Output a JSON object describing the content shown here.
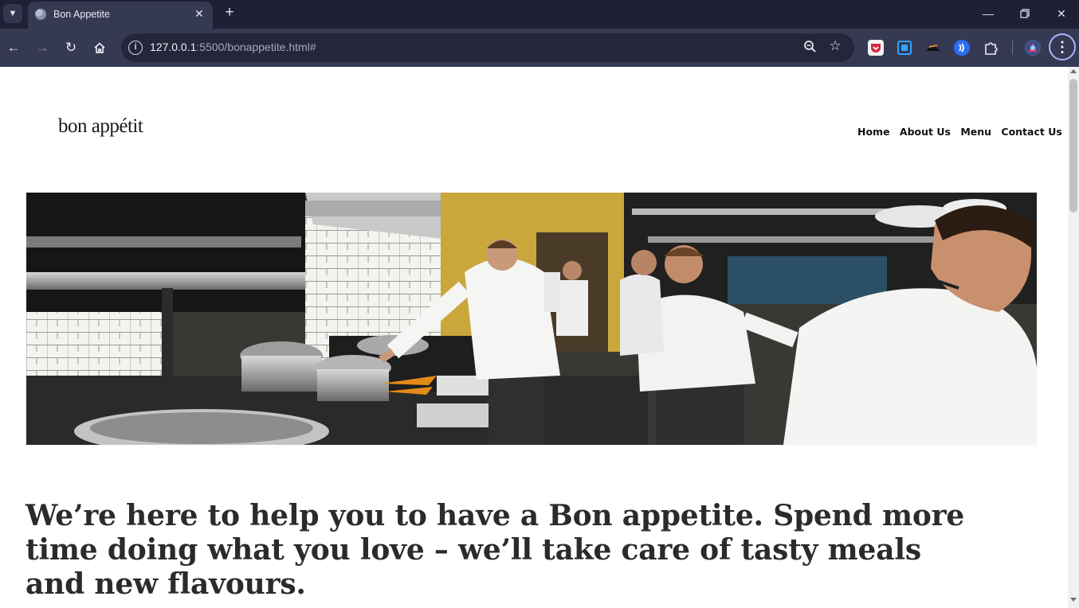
{
  "browser": {
    "tab_title": "Bon Appetite",
    "url_host": "127.0.0.1",
    "url_rest": ":5500/bonappetite.html#",
    "new_tab_glyph": "+",
    "tab_close_glyph": "✕",
    "icons": [
      "tab-list-icon",
      "site-favicon-icon",
      "back-icon",
      "forward-icon",
      "reload-icon",
      "home-icon",
      "site-info-icon",
      "zoom-icon",
      "bookmark-star-icon",
      "extensions-icon",
      "menu-icon"
    ]
  },
  "page": {
    "logo": "bon appétit",
    "nav": {
      "home": "Home",
      "about": "About Us",
      "menu": "Menu",
      "contact": "Contact Us"
    },
    "hero_alt": "",
    "headline": "We’re here to help you to have a Bon appetite. Spend more time doing what you love – we’ll take care of tasty meals and new flavours."
  },
  "colors": {
    "tabbar_bg": "#1f2033",
    "toolbar_bg": "#363952",
    "omnibox_bg": "#24263a",
    "headline_text": "#2b2b2b"
  }
}
